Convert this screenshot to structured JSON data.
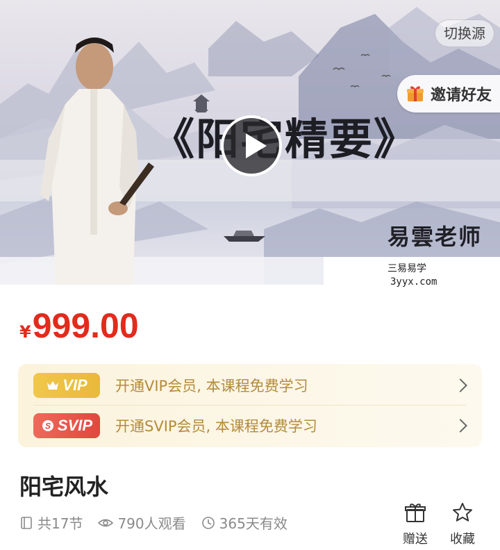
{
  "hero": {
    "switch_source_label": "切换源",
    "invite_label": "邀请好友",
    "course_cover_title": "《阳宅精要》",
    "teacher_name": "易雲老师",
    "watermark_line1": "三易易学",
    "watermark_line2": "3yyx.com",
    "icons": [
      "gift-icon",
      "play-icon"
    ]
  },
  "price": {
    "currency": "¥",
    "amount": "999.00",
    "color": "#e22b1c"
  },
  "membership": {
    "vip_badge": "VIP",
    "vip_text": "开通VIP会员, 本课程免费学习",
    "svip_badge": "SVIP",
    "svip_text": "开通SVIP会员, 本课程免费学习",
    "vip_color": "#efc143",
    "svip_color": "#e5503f"
  },
  "course": {
    "title": "阳宅风水",
    "lessons": "共17节",
    "views": "790人观看",
    "validity": "365天有效"
  },
  "actions": {
    "gift_label": "赠送",
    "favorite_label": "收藏"
  }
}
